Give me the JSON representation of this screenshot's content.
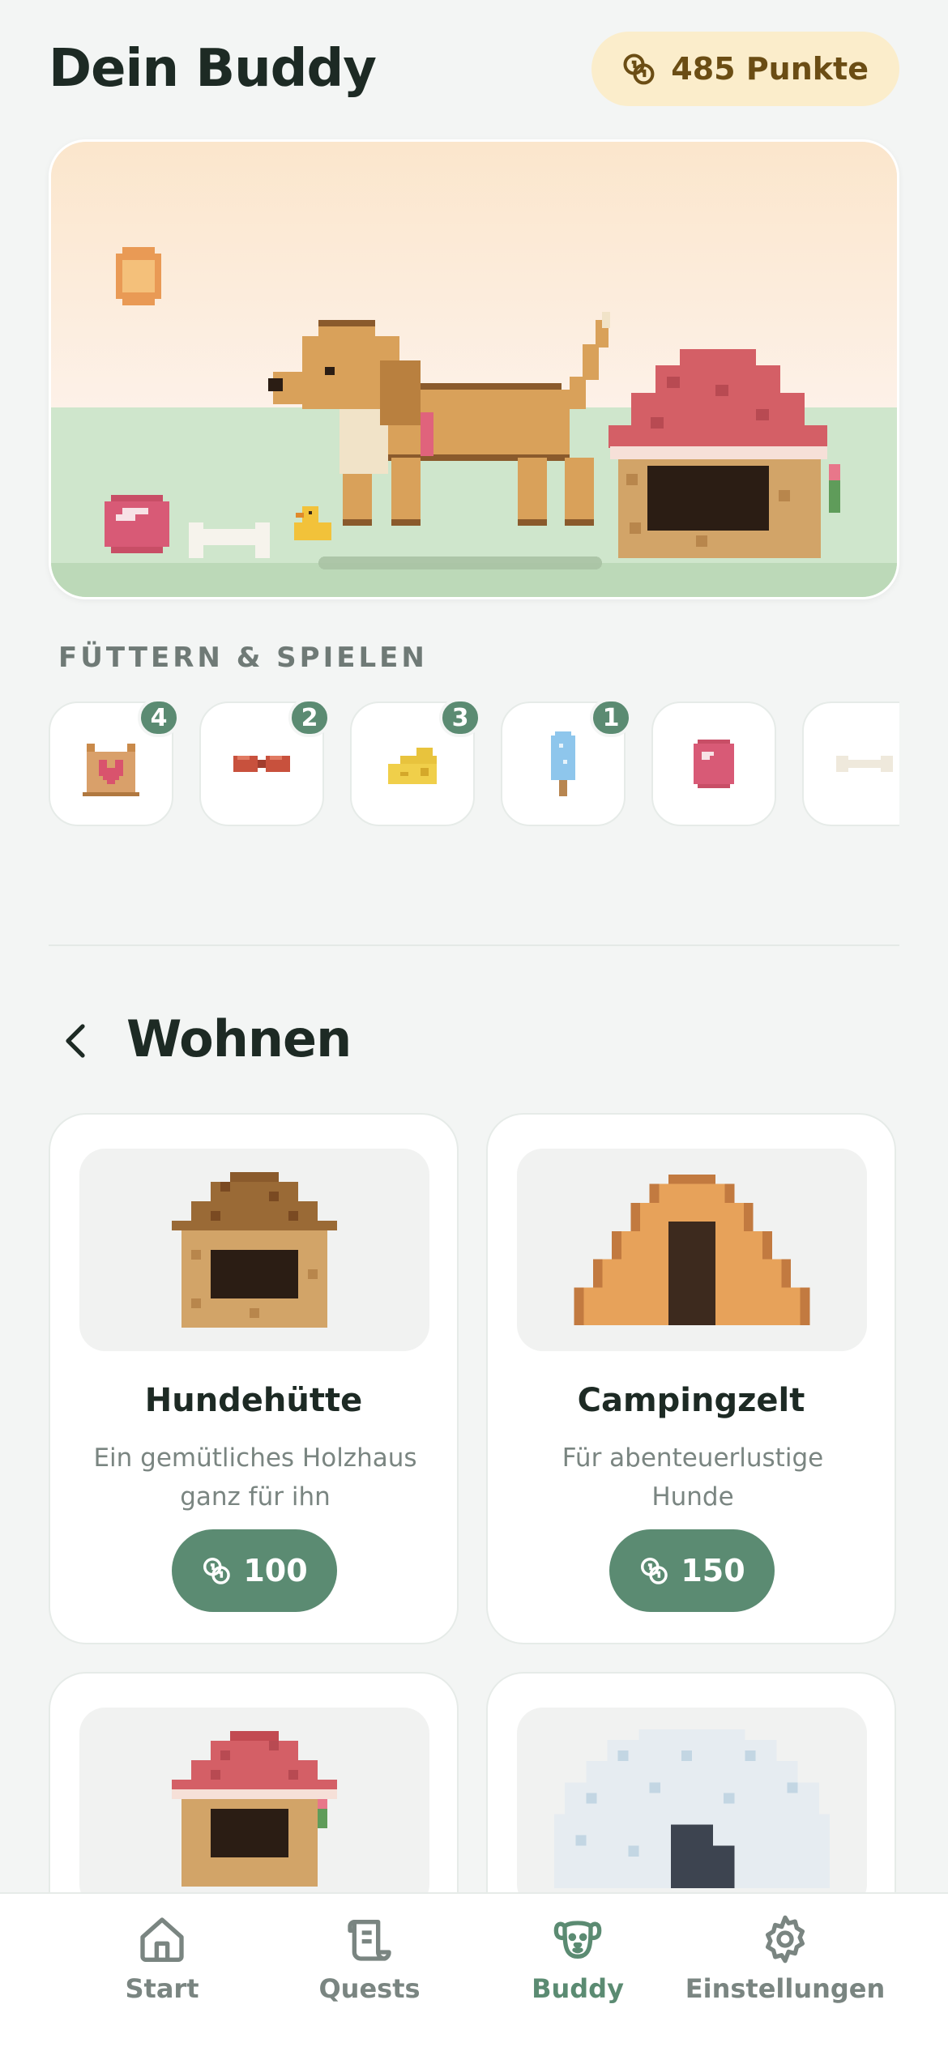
{
  "header": {
    "title": "Dein Buddy",
    "points_label": "485 Punkte"
  },
  "feed_section": {
    "label": "FÜTTERN & SPIELEN",
    "items": [
      {
        "icon": "treat-bag-icon",
        "count": "4"
      },
      {
        "icon": "sausage-icon",
        "count": "2"
      },
      {
        "icon": "cheese-icon",
        "count": "3"
      },
      {
        "icon": "popsicle-icon",
        "count": "1"
      },
      {
        "icon": "ball-icon",
        "count": null
      },
      {
        "icon": "bone-icon",
        "count": null
      }
    ]
  },
  "housing": {
    "title": "Wohnen",
    "cards": [
      {
        "name": "Hundehütte",
        "description": "Ein gemütliches Holzhaus ganz für ihn",
        "price": "100"
      },
      {
        "name": "Campingzelt",
        "description": "Für abenteuerlustige Hunde",
        "price": "150"
      },
      {
        "name": "",
        "description": "",
        "price": ""
      },
      {
        "name": "",
        "description": "",
        "price": ""
      }
    ]
  },
  "nav": {
    "items": [
      {
        "label": "Start",
        "icon": "home-icon"
      },
      {
        "label": "Quests",
        "icon": "scroll-icon"
      },
      {
        "label": "Buddy",
        "icon": "dog-face-icon",
        "active": true
      },
      {
        "label": "Einstellungen",
        "icon": "gear-icon"
      }
    ]
  },
  "colors": {
    "accent": "#5b8b72",
    "points_bg": "#fbedcb",
    "background": "#f3f5f4"
  }
}
